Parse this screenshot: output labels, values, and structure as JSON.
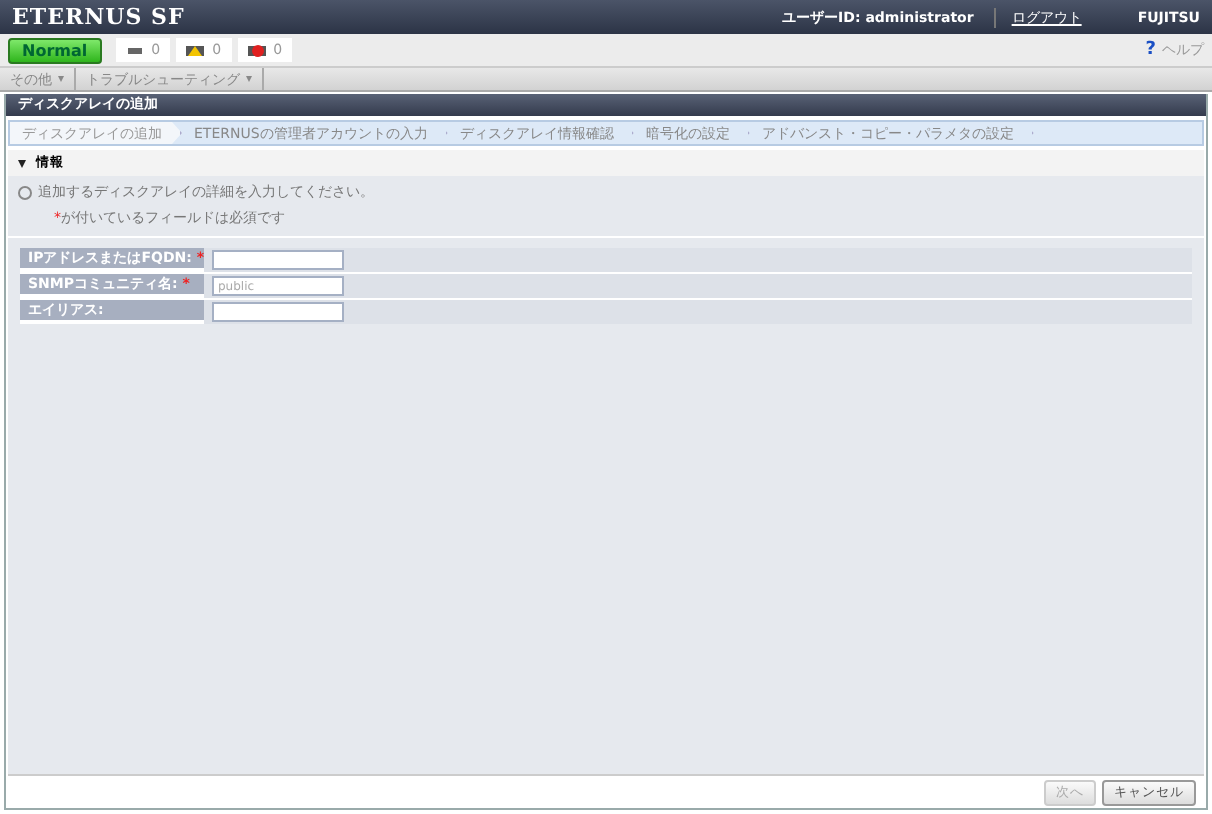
{
  "header": {
    "logo": "ETERNUS SF",
    "user": "ユーザーID: administrator",
    "logout": "ログアウト",
    "brand": "FUJITSU"
  },
  "status": {
    "overall": "Normal",
    "counters": [
      {
        "kind": "info",
        "count": "0"
      },
      {
        "kind": "warning",
        "count": "0"
      },
      {
        "kind": "error",
        "count": "0"
      }
    ],
    "help": "ヘルプ",
    "help_icon": "?"
  },
  "menus": [
    {
      "label": "その他",
      "caret": "▾"
    },
    {
      "label": "トラブルシューティング",
      "caret": "▾"
    }
  ],
  "panel": {
    "title": "ディスクアレイの追加",
    "steps": [
      {
        "label": "ディスクアレイの追加",
        "selected": true
      },
      {
        "label": "ETERNUSの管理者アカウントの入力",
        "selected": false
      },
      {
        "label": "ディスクアレイ情報確認",
        "selected": false
      },
      {
        "label": "暗号化の設定",
        "selected": false
      },
      {
        "label": "アドバンスト・コピー・パラメタの設定",
        "selected": false
      }
    ],
    "section": {
      "title": "情報",
      "expanded": true
    },
    "info": [
      "追加するディスクアレイの詳細を入力してください。",
      "が付いているフィールドは必須です"
    ],
    "required_mark": "*",
    "fields": [
      {
        "label": "IPアドレスまたはFQDN:",
        "required": true
      },
      {
        "label": "SNMPコミュニティ名:",
        "required": true,
        "value": "public"
      },
      {
        "label": "エイリアス:",
        "required": false
      }
    ],
    "buttons": [
      {
        "label": "次へ",
        "disabled": true
      },
      {
        "label": "キャンセル",
        "disabled": false
      }
    ]
  }
}
